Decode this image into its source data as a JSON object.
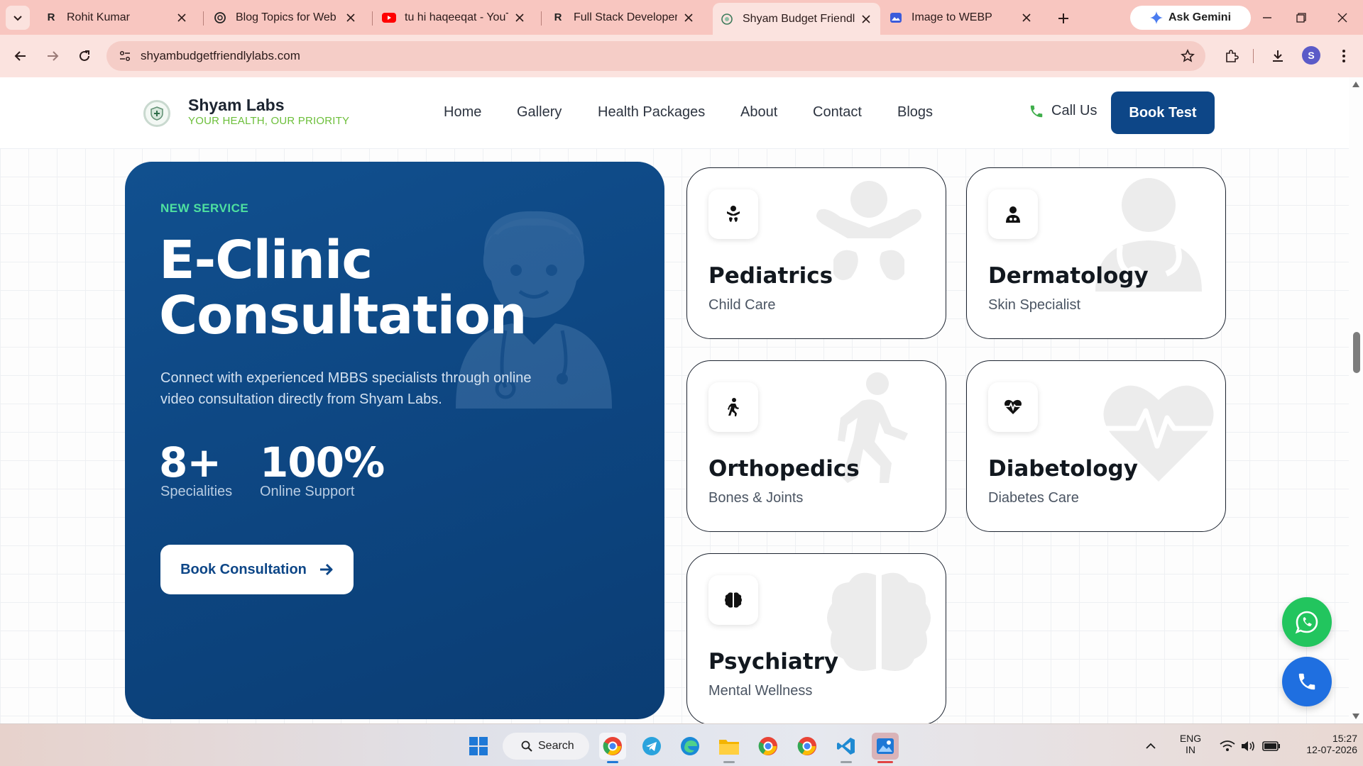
{
  "browser": {
    "tabs": [
      {
        "title": "Rohit Kumar",
        "favicon": "rk-icon"
      },
      {
        "title": "Blog Topics for Web D",
        "favicon": "chatgpt-icon"
      },
      {
        "title": "tu hi haqeeqat - YouTu",
        "favicon": "youtube-icon"
      },
      {
        "title": "Full Stack Developer",
        "favicon": "rk-icon"
      },
      {
        "title": "Shyam Budget Friendly",
        "favicon": "globe-icon",
        "active": true
      },
      {
        "title": "Image to WEBP",
        "favicon": "image-icon"
      }
    ],
    "gemini_label": "Ask Gemini",
    "url": "shyambudgetfriendlylabs.com",
    "profile_initial": "S"
  },
  "site": {
    "brand": "Shyam Labs",
    "tagline": "YOUR HEALTH, OUR PRIORITY",
    "nav": [
      "Home",
      "Gallery",
      "Health Packages",
      "About",
      "Contact",
      "Blogs"
    ],
    "call_label": "Call Us",
    "book_test_label": "Book Test"
  },
  "hero": {
    "kicker": "NEW SERVICE",
    "title_line1": "E-Clinic",
    "title_line2": "Consultation",
    "description": "Connect with experienced MBBS specialists through online video consultation directly from Shyam Labs.",
    "stats": [
      {
        "value": "8+",
        "label": "Specialities"
      },
      {
        "value": "100%",
        "label": "Online Support"
      }
    ],
    "cta_label": "Book Consultation"
  },
  "specialities": [
    {
      "title": "Pediatrics",
      "subtitle": "Child Care",
      "icon": "baby-icon"
    },
    {
      "title": "Dermatology",
      "subtitle": "Skin Specialist",
      "icon": "doctor-icon"
    },
    {
      "title": "Orthopedics",
      "subtitle": "Bones & Joints",
      "icon": "walking-icon"
    },
    {
      "title": "Diabetology",
      "subtitle": "Diabetes Care",
      "icon": "heartbeat-icon"
    },
    {
      "title": "Psychiatry",
      "subtitle": "Mental Wellness",
      "icon": "brain-icon"
    }
  ],
  "taskbar": {
    "search_label": "Search",
    "lang_line1": "ENG",
    "lang_line2": "IN",
    "time": "15:27",
    "date": "12-07-2026"
  },
  "colors": {
    "brand_blue": "#0d4687",
    "accent_green": "#4ee0a0",
    "tagline_green": "#6cbf3a",
    "whatsapp_green": "#22c55e",
    "call_blue": "#1f6fe0"
  }
}
